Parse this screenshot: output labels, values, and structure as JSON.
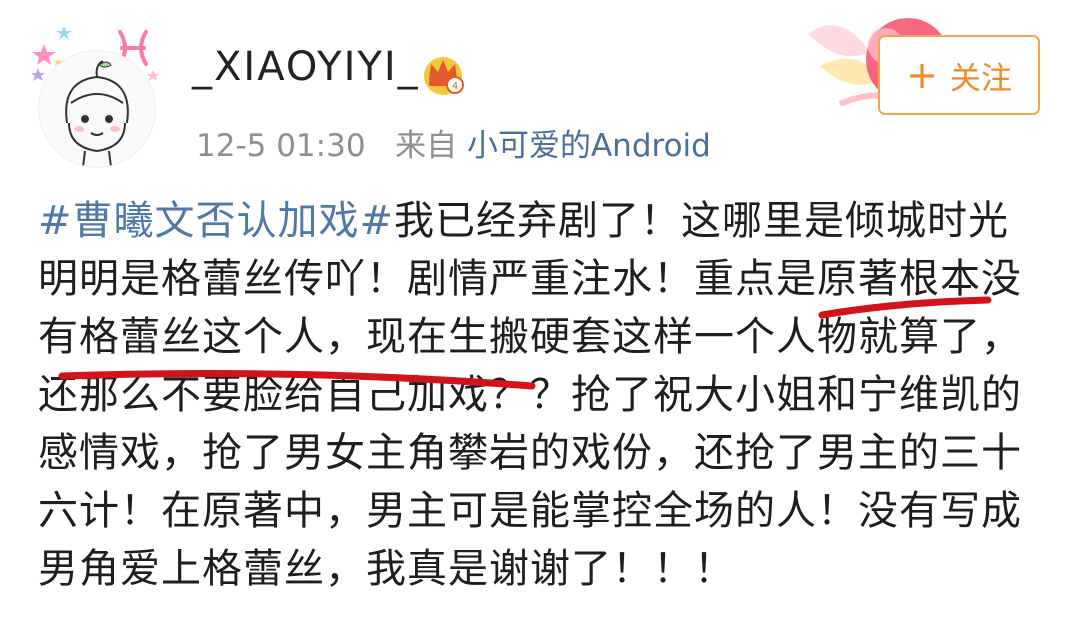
{
  "post": {
    "author": {
      "name": "_XIAOYIYI_",
      "badge_icon": "crown-icon",
      "avatar_icon": "cartoon-girl-avatar-icon"
    },
    "timestamp": "12-5 01:30",
    "source_prefix": "来自",
    "source_app": "小可爱的Android",
    "follow": {
      "plus": "+",
      "label": "关注"
    },
    "hashtag": "#曹曦文否认加戏#",
    "body": "我已经弃剧了！这哪里是倾城时光 明明是格蕾丝传吖！剧情严重注水！重点是原著根本没有格蕾丝这个人，现在生搬硬套这样一个人物就算了，还那么不要脸给自己加戏？？抢了祝大小姐和宁维凯的感情戏，抢了男女主角攀岩的戏份，还抢了男主的三十六计！在原著中，男主可是能掌控全场的人！没有写成男角爱上格蕾丝，我真是谢谢了！！！"
  },
  "colors": {
    "hashtag": "#4f7aa8",
    "source_link": "#4a6f9d",
    "follow_accent": "#f08a24",
    "underline_marker": "#d4121b"
  }
}
